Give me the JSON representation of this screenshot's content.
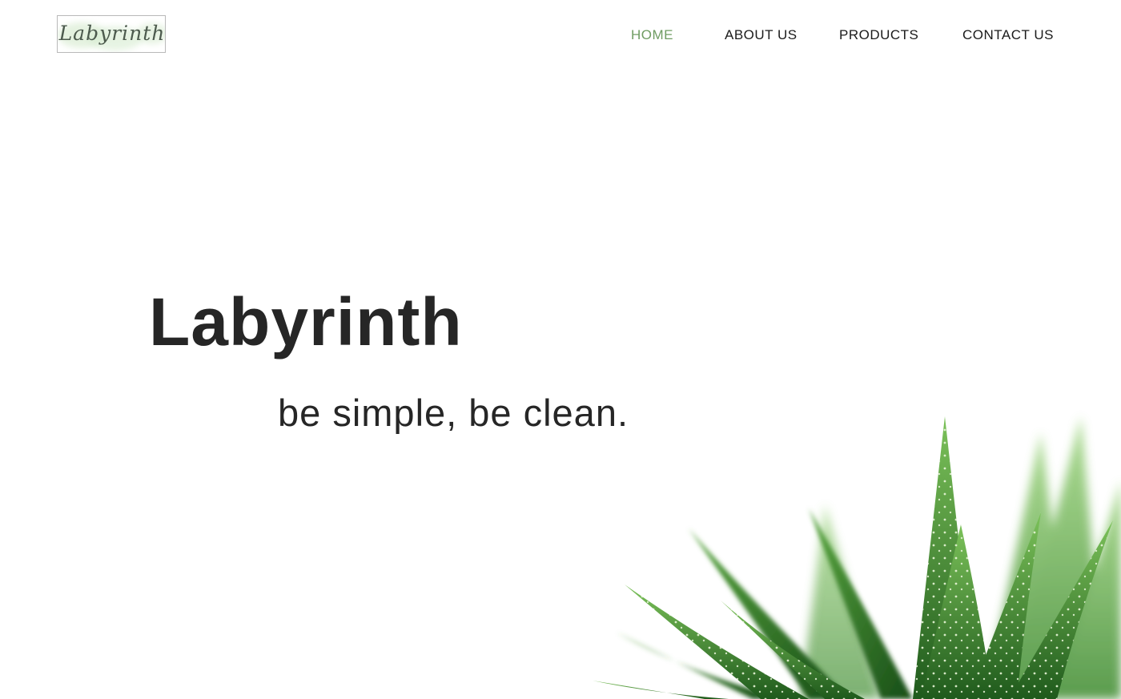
{
  "header": {
    "logo_text": "Labyrinth",
    "nav": [
      {
        "label": "HOME",
        "active": true
      },
      {
        "label": "ABOUT US",
        "active": false
      },
      {
        "label": "PRODUCTS",
        "active": false
      },
      {
        "label": "CONTACT US",
        "active": false
      }
    ]
  },
  "hero": {
    "title": "Labyrinth",
    "tagline": "be simple, be clean.",
    "image": "aloe-plant"
  },
  "colors": {
    "accent": "#6f9c62",
    "text": "#262626",
    "nav_text": "#1b1b1b",
    "background": "#ffffff",
    "plant_green": "#2e7d2a"
  }
}
